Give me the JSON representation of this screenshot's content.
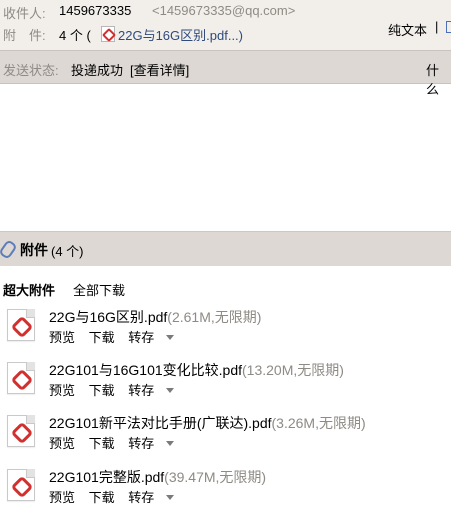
{
  "header": {
    "sender_label": "收件人:",
    "sender_name": "1459673335",
    "sender_email": "<1459673335@qq.com>",
    "attachment_label": "附　件:",
    "attachment_count_text": "4 个 (",
    "attachment_preview_name": "22G与16G区别.pdf...)",
    "plain_text": "纯文本",
    "plain_separator": "|"
  },
  "status": {
    "label": "发送状态:",
    "value": "投递成功",
    "detail_link": "[查看详情]",
    "truncated": "什么"
  },
  "attachments_bar": {
    "title": "附件",
    "count": "(4 个)"
  },
  "big_attachments": {
    "title": "超大附件",
    "download_all": "全部下载"
  },
  "files": [
    {
      "name": "22G与16G区别.pdf",
      "meta": "(2.61M,无限期)",
      "preview": "预览",
      "download": "下载",
      "save": "转存"
    },
    {
      "name": "22G101与16G101变化比较.pdf",
      "meta": "(13.20M,无限期)",
      "preview": "预览",
      "download": "下载",
      "save": "转存"
    },
    {
      "name": "22G101新平法对比手册(广联达).pdf",
      "meta": "(3.26M,无限期)",
      "preview": "预览",
      "download": "下载",
      "save": "转存"
    },
    {
      "name": "22G101完整版.pdf",
      "meta": "(39.47M,无限期)",
      "preview": "预览",
      "download": "下载",
      "save": "转存"
    }
  ],
  "colors": {
    "header_bg": "#f2efeb",
    "bar_bg": "#ddd8d3",
    "muted_text": "#8e8a84",
    "pdf_red": "#d22f2f"
  }
}
